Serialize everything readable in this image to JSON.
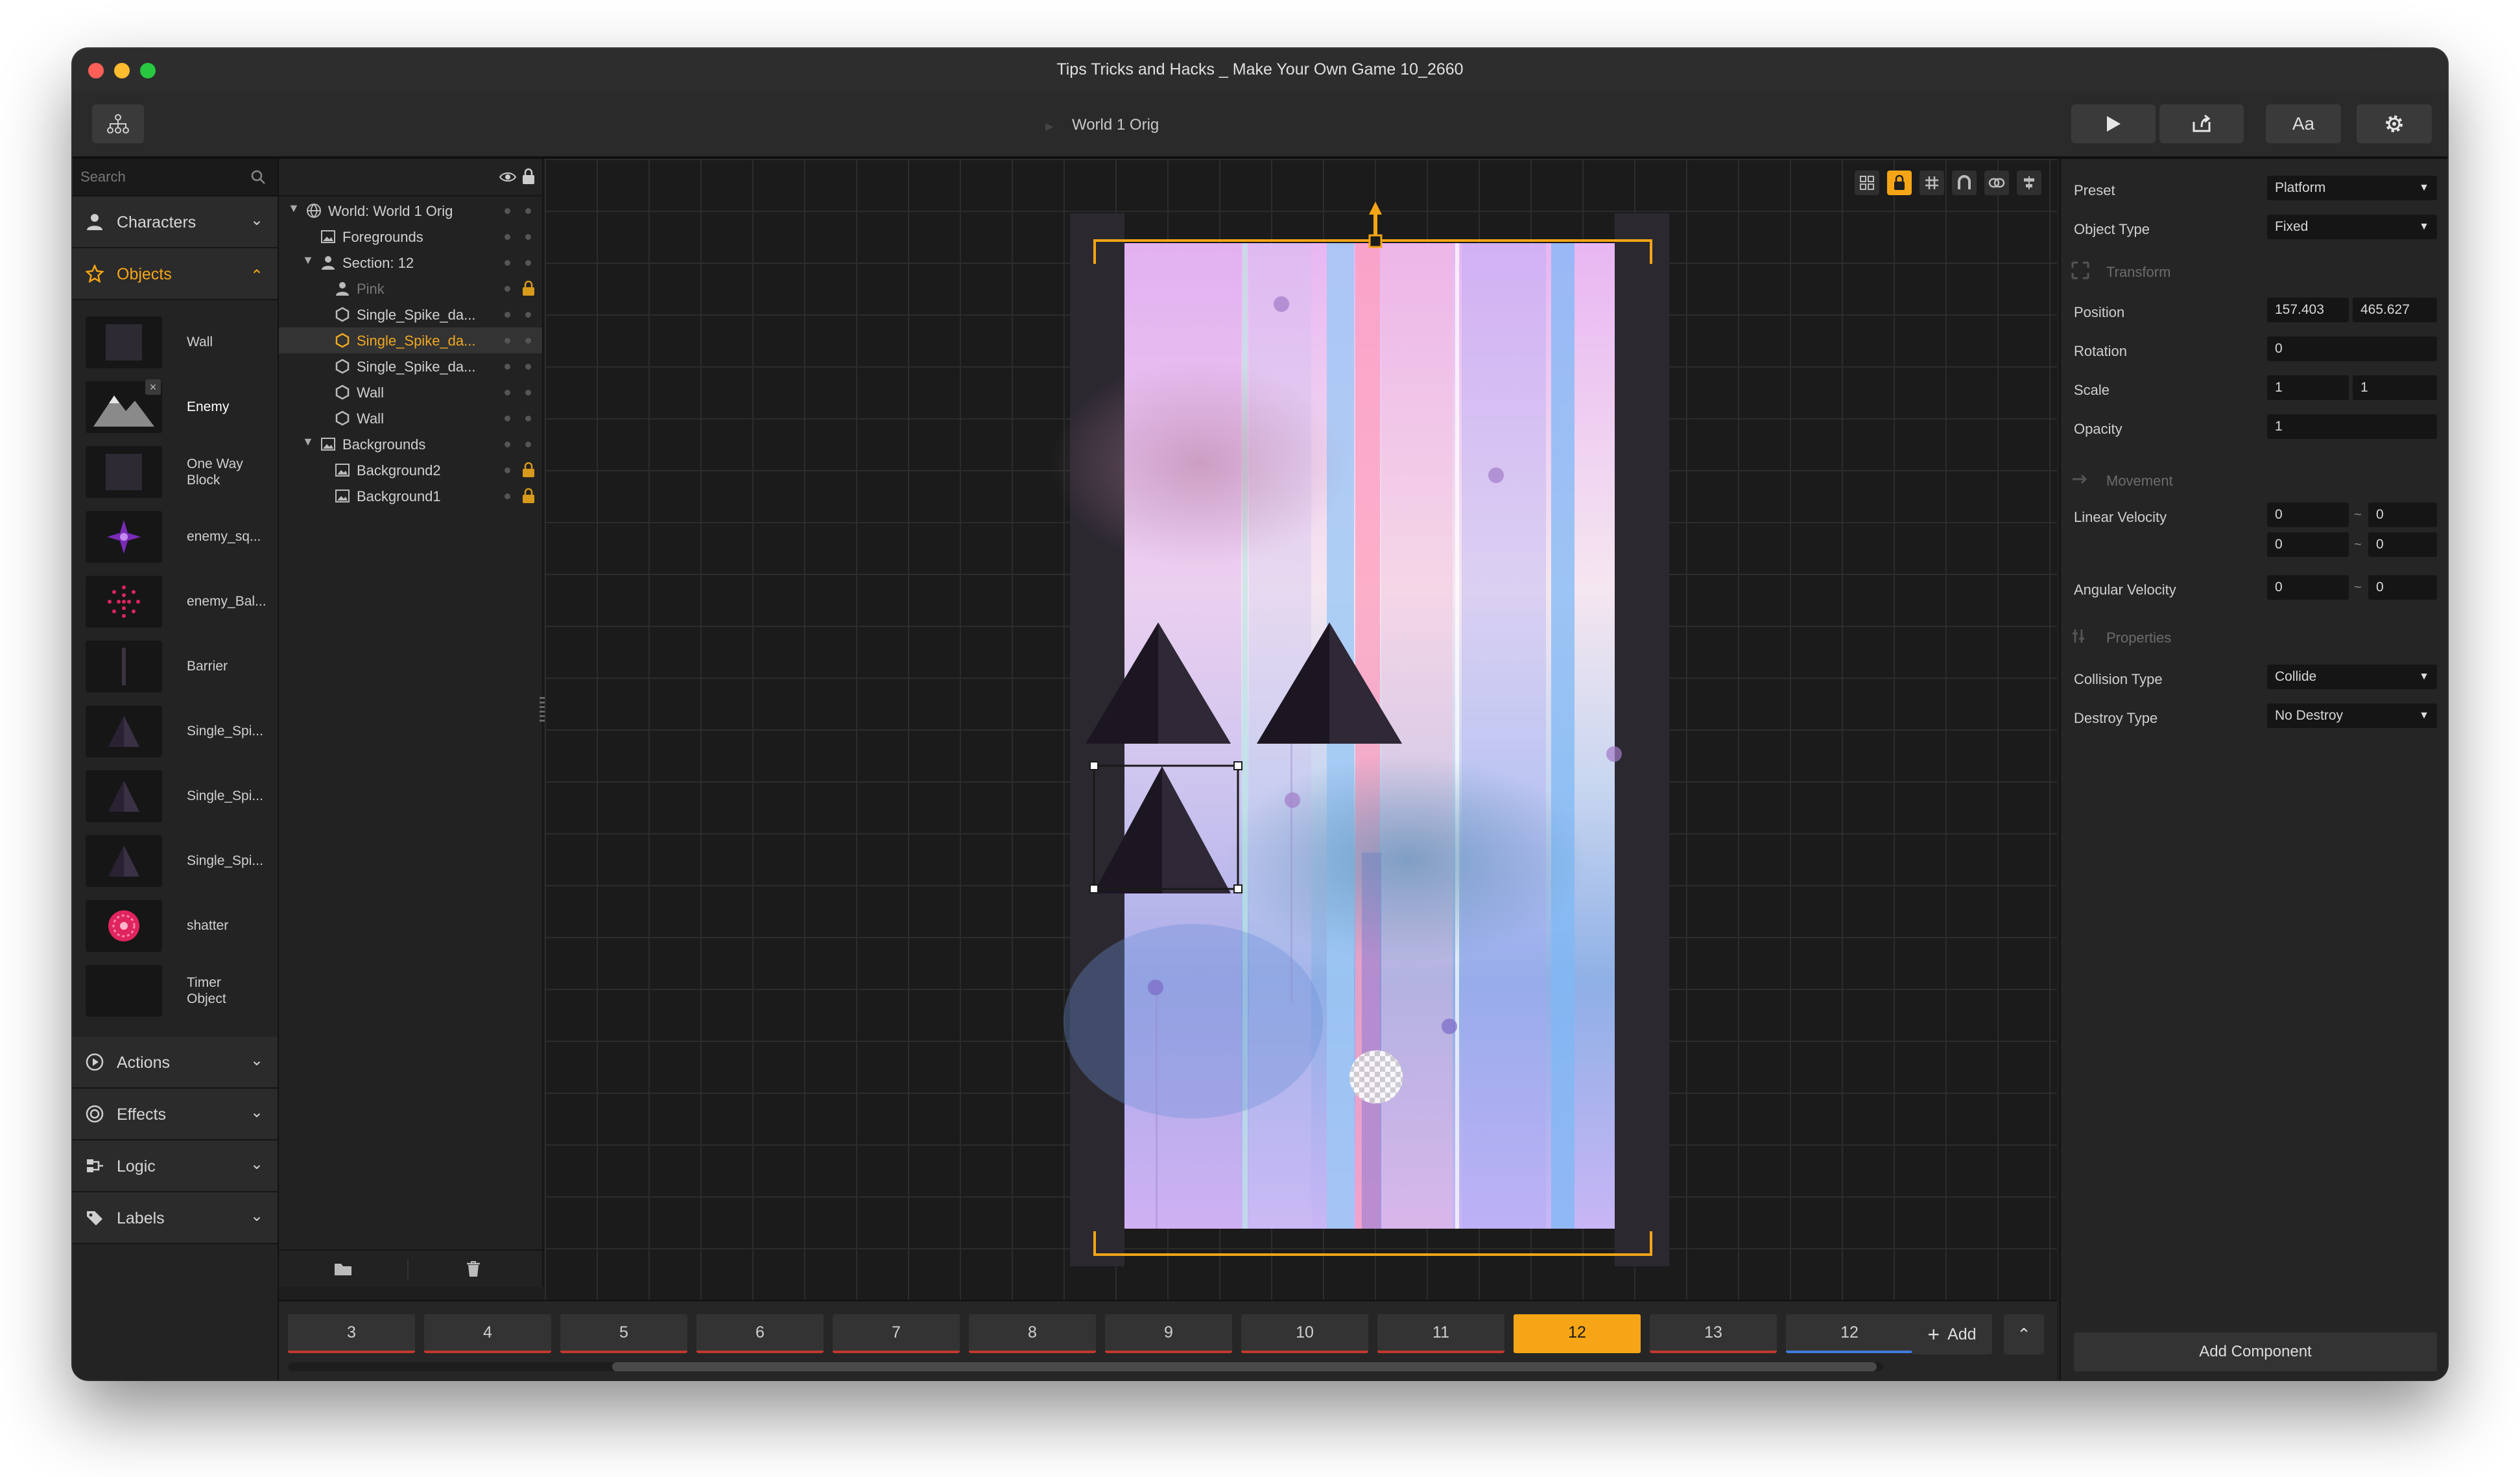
{
  "window": {
    "title": "Tips Tricks and Hacks _ Make Your Own Game 10_2660"
  },
  "toolbar": {
    "breadcrumb": "World 1 Orig",
    "font_label": "Aa"
  },
  "library": {
    "search_placeholder": "Search",
    "categories_top": [
      {
        "label": "Characters",
        "icon": "person-icon",
        "expanded": false
      },
      {
        "label": "Objects",
        "icon": "star-icon",
        "expanded": true
      }
    ],
    "objects": [
      {
        "name": "Wall",
        "thumb": "wall"
      },
      {
        "name": "Enemy",
        "thumb": "mountain"
      },
      {
        "name": "One Way Block",
        "thumb": "wall"
      },
      {
        "name": "enemy_sq...",
        "thumb": "purple-star"
      },
      {
        "name": "enemy_Bal...",
        "thumb": "pink-dots"
      },
      {
        "name": "Barrier",
        "thumb": "barrier"
      },
      {
        "name": "Single_Spi...",
        "thumb": "spike"
      },
      {
        "name": "Single_Spi...",
        "thumb": "spike"
      },
      {
        "name": "Single_Spi...",
        "thumb": "spike"
      },
      {
        "name": "shatter",
        "thumb": "shatter"
      },
      {
        "name": "Timer Object",
        "thumb": "blank"
      }
    ],
    "categories_bottom": [
      {
        "label": "Actions",
        "icon": "play-circle-icon"
      },
      {
        "label": "Effects",
        "icon": "swirl-icon"
      },
      {
        "label": "Logic",
        "icon": "logic-icon"
      },
      {
        "label": "Labels",
        "icon": "tag-icon"
      }
    ]
  },
  "hierarchy": {
    "rows": [
      {
        "label": "World: World 1 Orig",
        "icon": "globe-icon",
        "indent": 0,
        "arrow": "▼",
        "state": "normal",
        "lock": false
      },
      {
        "label": "Foregrounds",
        "icon": "image-icon",
        "indent": 1,
        "arrow": "",
        "state": "normal",
        "lock": false
      },
      {
        "label": "Section: 12",
        "icon": "person-icon",
        "indent": 1,
        "arrow": "▼",
        "state": "normal",
        "lock": false
      },
      {
        "label": "Pink",
        "icon": "person-icon",
        "indent": 2,
        "arrow": "",
        "state": "dim",
        "lock": true
      },
      {
        "label": "Single_Spike_da...",
        "icon": "hexagon-icon",
        "indent": 2,
        "arrow": "",
        "state": "normal",
        "lock": false
      },
      {
        "label": "Single_Spike_da...",
        "icon": "hexagon-icon",
        "indent": 2,
        "arrow": "",
        "state": "selected",
        "lock": false
      },
      {
        "label": "Single_Spike_da...",
        "icon": "hexagon-icon",
        "indent": 2,
        "arrow": "",
        "state": "normal",
        "lock": false
      },
      {
        "label": "Wall",
        "icon": "hexagon-icon",
        "indent": 2,
        "arrow": "",
        "state": "normal",
        "lock": false
      },
      {
        "label": "Wall",
        "icon": "hexagon-icon",
        "indent": 2,
        "arrow": "",
        "state": "normal",
        "lock": false
      },
      {
        "label": "Backgrounds",
        "icon": "image-icon",
        "indent": 1,
        "arrow": "▼",
        "state": "normal",
        "lock": false
      },
      {
        "label": "Background2",
        "icon": "image-icon",
        "indent": 2,
        "arrow": "",
        "state": "normal",
        "lock": true
      },
      {
        "label": "Background1",
        "icon": "image-icon",
        "indent": 2,
        "arrow": "",
        "state": "normal",
        "lock": true
      }
    ]
  },
  "timeline": {
    "sections": [
      {
        "label": "3",
        "state": "normal"
      },
      {
        "label": "4",
        "state": "normal"
      },
      {
        "label": "5",
        "state": "normal"
      },
      {
        "label": "6",
        "state": "normal"
      },
      {
        "label": "7",
        "state": "normal"
      },
      {
        "label": "8",
        "state": "normal"
      },
      {
        "label": "9",
        "state": "normal"
      },
      {
        "label": "10",
        "state": "normal"
      },
      {
        "label": "11",
        "state": "normal"
      },
      {
        "label": "12",
        "state": "active"
      },
      {
        "label": "13",
        "state": "normal"
      },
      {
        "label": "12",
        "state": "blue"
      }
    ],
    "add_label": "Add"
  },
  "inspector": {
    "preset_label": "Preset",
    "preset_value": "Platform",
    "object_type_label": "Object Type",
    "object_type_value": "Fixed",
    "transform_header": "Transform",
    "position_label": "Position",
    "position_x": "157.403",
    "position_y": "465.627",
    "rotation_label": "Rotation",
    "rotation_value": "0",
    "scale_label": "Scale",
    "scale_x": "1",
    "scale_y": "1",
    "opacity_label": "Opacity",
    "opacity_value": "1",
    "movement_header": "Movement",
    "linear_velocity_label": "Linear Velocity",
    "linear_x_min": "0",
    "linear_x_max": "0",
    "linear_y_min": "0",
    "linear_y_max": "0",
    "angular_velocity_label": "Angular Velocity",
    "angular_min": "0",
    "angular_max": "0",
    "properties_header": "Properties",
    "collision_type_label": "Collision Type",
    "collision_type_value": "Collide",
    "destroy_type_label": "Destroy Type",
    "destroy_type_value": "No Destroy",
    "add_component_label": "Add Component"
  },
  "colors": {
    "accent": "#f5a516",
    "section_underline": "#c0392b",
    "section_underline_alt": "#3e7bd8",
    "panel_bg": "#232323",
    "canvas_bg": "#1b1b1b"
  }
}
